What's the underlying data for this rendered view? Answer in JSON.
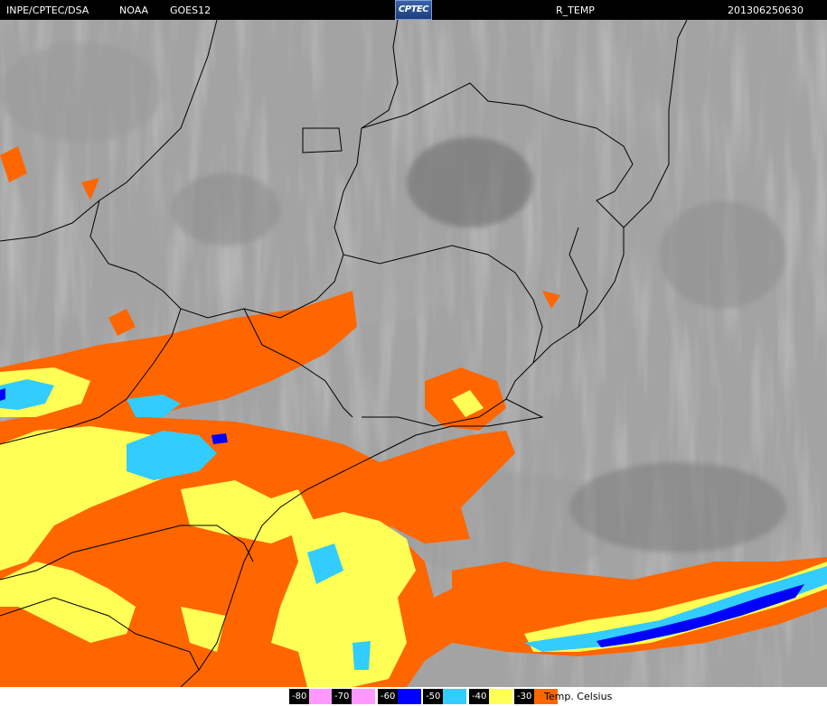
{
  "header": {
    "source": "INPE/CPTEC/DSA",
    "agency": "NOAA",
    "satellite": "GOES12",
    "logo_text": "CPTEC",
    "product": "R_TEMP",
    "timestamp": "201306250630"
  },
  "legend": {
    "items": [
      {
        "label": "-80",
        "color": "#ff99ff",
        "text_color": "#000000"
      },
      {
        "label": "-70",
        "color": "#ff99ff",
        "text_color": "#000000"
      },
      {
        "label": "-60",
        "color": "#0000ff",
        "text_color": "#ffffff"
      },
      {
        "label": "-50",
        "color": "#33ccff",
        "text_color": "#000000"
      },
      {
        "label": "-40",
        "color": "#ffff55",
        "text_color": "#000000"
      },
      {
        "label": "-30",
        "color": "#ff6600",
        "text_color": "#000000"
      }
    ],
    "unit": "Temp. Celsius"
  },
  "colors": {
    "background": "#000000",
    "cloud_gray_dark": "#4a4a4a",
    "cloud_gray_light": "#b9b9b9",
    "coastline": "#000000"
  }
}
